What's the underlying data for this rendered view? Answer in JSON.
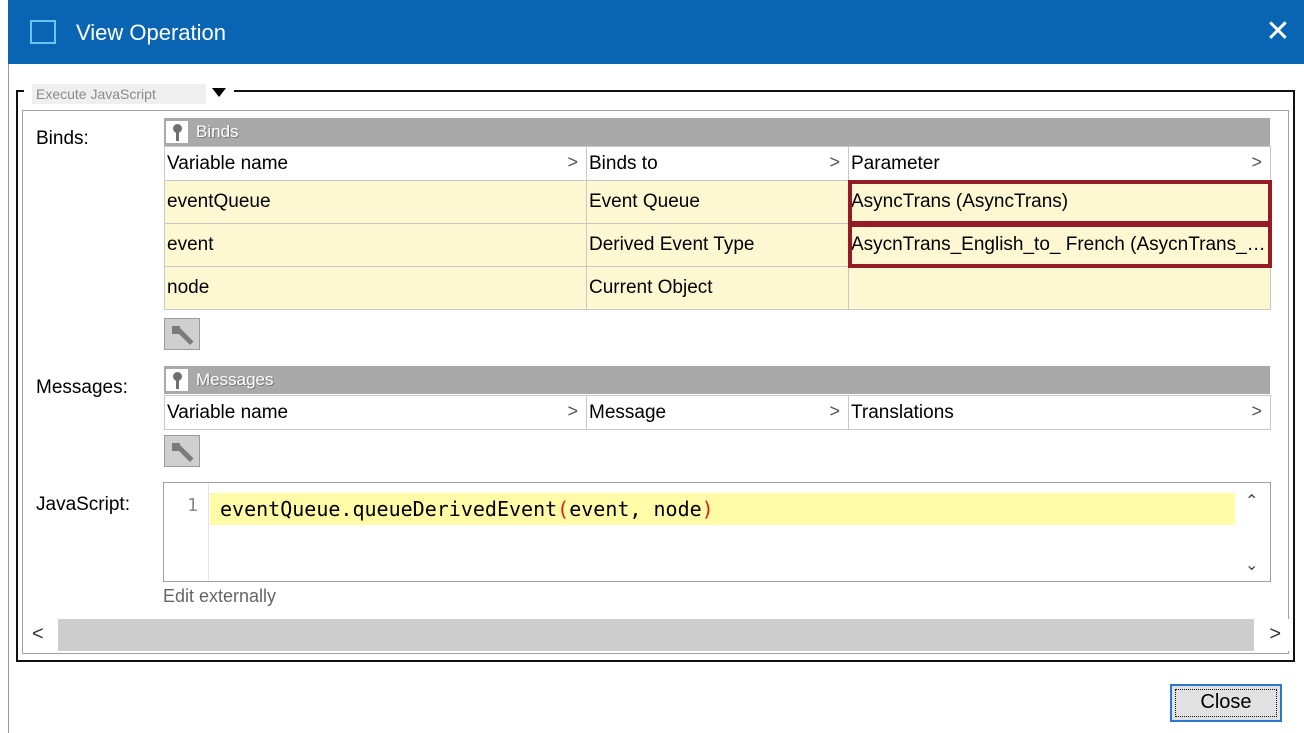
{
  "window": {
    "title": "View Operation",
    "close_glyph": "✕",
    "title_color": "#0a64b4"
  },
  "operation_type": {
    "selected": "Execute JavaScript"
  },
  "binds": {
    "label": "Binds:",
    "section_title": "Binds",
    "columns": [
      "Variable name",
      "Binds to",
      "Parameter"
    ],
    "rows": [
      {
        "variable": "eventQueue",
        "binds_to": "Event Queue",
        "parameter": "AsyncTrans (AsyncTrans)",
        "highlighted": true
      },
      {
        "variable": "event",
        "binds_to": "Derived Event Type",
        "parameter": "AsycnTrans_English_to_ French (AsycnTrans_English_to_French)",
        "highlighted": true
      },
      {
        "variable": "node",
        "binds_to": "Current Object",
        "parameter": "",
        "highlighted": false
      }
    ]
  },
  "messages": {
    "label": "Messages:",
    "section_title": "Messages",
    "columns": [
      "Variable name",
      "Message",
      "Translations"
    ]
  },
  "javascript": {
    "label": "JavaScript:",
    "line_number": "1",
    "code_prefix": "eventQueue.queueDerivedEvent",
    "open_paren": "(",
    "code_args": "event, node",
    "close_paren": ")",
    "edit_externally": "Edit externally"
  },
  "footer": {
    "close_label": "Close"
  },
  "icons": {
    "pin": "pin-icon",
    "edit": "edit-pencil-icon",
    "chevron": "chevron-right-icon",
    "scroll_up": "scroll-up-icon",
    "scroll_down": "scroll-down-icon",
    "scroll_left": "scroll-left-icon",
    "scroll_right": "scroll-right-icon"
  },
  "colors": {
    "row_fill": "#fdf7d2",
    "highlight": "#951c26",
    "code_line": "#fffba6",
    "section_header": "#a9a9a9"
  }
}
